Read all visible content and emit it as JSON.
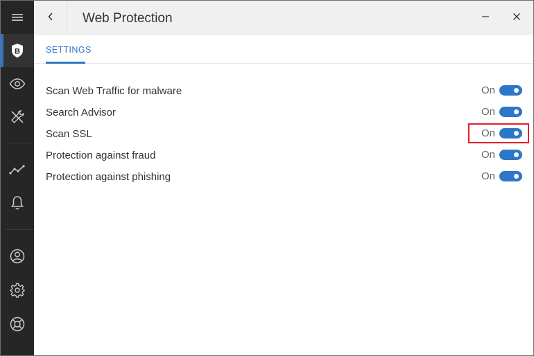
{
  "sidebar": {
    "brand_letter": "B",
    "items": [
      {
        "name": "menu",
        "icon": "hamburger-icon"
      },
      {
        "name": "protection",
        "icon": "shield-b-icon",
        "active": true
      },
      {
        "name": "privacy",
        "icon": "eye-icon"
      },
      {
        "name": "utilities",
        "icon": "tools-icon"
      },
      {
        "name": "reports",
        "icon": "activity-chart-icon"
      },
      {
        "name": "notifications",
        "icon": "bell-icon"
      },
      {
        "name": "account",
        "icon": "user-circle-icon"
      },
      {
        "name": "settings",
        "icon": "gear-icon"
      },
      {
        "name": "support",
        "icon": "lifebuoy-icon"
      }
    ]
  },
  "header": {
    "title": "Web Protection",
    "back_icon": "chevron-left-icon",
    "minimize_icon": "minimize-icon",
    "close_icon": "close-icon"
  },
  "tabs": [
    {
      "label": "SETTINGS",
      "active": true
    }
  ],
  "settings": [
    {
      "label": "Scan Web Traffic for malware",
      "state": "On",
      "enabled": true
    },
    {
      "label": "Search Advisor",
      "state": "On",
      "enabled": true
    },
    {
      "label": "Scan SSL",
      "state": "On",
      "enabled": true,
      "highlighted": true
    },
    {
      "label": "Protection against fraud",
      "state": "On",
      "enabled": true
    },
    {
      "label": "Protection against phishing",
      "state": "On",
      "enabled": true
    }
  ],
  "colors": {
    "accent": "#2d77c8",
    "sidebar_bg": "#262626",
    "header_bg": "#f0f0f0",
    "highlight": "#e32028"
  }
}
